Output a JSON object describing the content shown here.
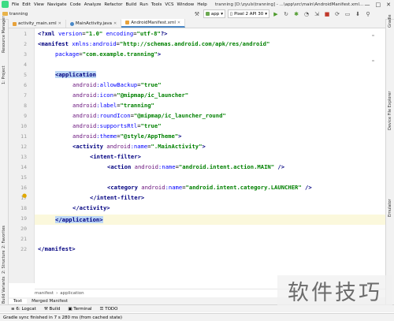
{
  "window": {
    "title": "tranning [D:\\zyuls\\tranning] - ...\\app\\src\\main\\AndroidManifest.xml [app]",
    "controls": [
      "—",
      "□",
      "✕"
    ]
  },
  "menu": [
    "File",
    "Edit",
    "View",
    "Navigate",
    "Code",
    "Analyze",
    "Refactor",
    "Build",
    "Run",
    "Tools",
    "VCS",
    "Window",
    "Help"
  ],
  "nav": {
    "project": "tranning"
  },
  "toolbar": {
    "module_combo": "app",
    "device_combo": "Pixel 2 API 30"
  },
  "left_tool_windows": [
    "1: Project",
    "Resource Manager",
    "2: Structure",
    "2: Favorites",
    "Build Variants"
  ],
  "right_tool_windows": [
    "Gradle",
    "Device File Explorer",
    "Emulator"
  ],
  "tabs": [
    {
      "label": "activity_main.xml",
      "icon_color": "#e8a23a"
    },
    {
      "label": "MainActivity.java",
      "icon_color": "#4a88c7"
    },
    {
      "label": "AndroidManifest.xml",
      "icon_color": "#e8a23a"
    }
  ],
  "line_numbers": [
    "1",
    "2",
    "3",
    "4",
    "5",
    "6",
    "7",
    "8",
    "9",
    "10",
    "11",
    "12",
    "13",
    "14",
    "15",
    "16",
    "17",
    "18",
    "19",
    "20",
    "21",
    "22"
  ],
  "code": {
    "l1": {
      "p1": "<?",
      "p2": "xml ",
      "p3": "version",
      "p4": "=",
      "p5": "\"1.0\"",
      "p6": " ",
      "p7": "encoding",
      "p8": "=",
      "p9": "\"utf-8\"",
      "p10": "?>"
    },
    "l2": {
      "p1": "<",
      "p2": "manifest ",
      "p3": "xmlns:",
      "p4": "android",
      "p5": "=",
      "p6": "\"http://schemas.android.com/apk/res/android\""
    },
    "l3": {
      "p1": "package",
      "p2": "=",
      "p3": "\"com.example.tranning\"",
      "p4": ">"
    },
    "l5": {
      "p1": "<application"
    },
    "l6": {
      "p1": "android",
      "p2": ":allowBackup",
      "p3": "=",
      "p4": "\"true\""
    },
    "l7": {
      "p1": "android",
      "p2": ":icon",
      "p3": "=",
      "p4": "\"@mipmap/ic_launcher\""
    },
    "l8": {
      "p1": "android",
      "p2": ":label",
      "p3": "=",
      "p4": "\"tranning\""
    },
    "l9": {
      "p1": "android",
      "p2": ":roundIcon",
      "p3": "=",
      "p4": "\"@mipmap/ic_launcher_round\""
    },
    "l10": {
      "p1": "android",
      "p2": ":supportsRtl",
      "p3": "=",
      "p4": "\"true\""
    },
    "l11": {
      "p1": "android",
      "p2": ":theme",
      "p3": "=",
      "p4": "\"@style/AppTheme\"",
      "p5": ">"
    },
    "l12": {
      "p1": "<activity ",
      "p2": "android",
      "p3": ":name",
      "p4": "=",
      "p5": "\".MainActivity\"",
      "p6": ">"
    },
    "l13": {
      "p1": "<intent-filter>"
    },
    "l14": {
      "p1": "<action ",
      "p2": "android",
      "p3": ":name",
      "p4": "=",
      "p5": "\"android.intent.action.MAIN\"",
      "p6": " />"
    },
    "l16": {
      "p1": "<category ",
      "p2": "android",
      "p3": ":name",
      "p4": "=",
      "p5": "\"android.intent.category.LAUNCHER\"",
      "p6": " />"
    },
    "l17": {
      "p1": "</intent-filter>"
    },
    "l18": {
      "p1": "</activity>"
    },
    "l19": {
      "p1": "</application>"
    },
    "l21": {
      "p1": "</manifest>"
    }
  },
  "breadcrumb": [
    "manifest",
    "application"
  ],
  "editor_subtabs": [
    "Text",
    "Merged Manifest"
  ],
  "bottom_tools": [
    "6: Logcat",
    "Build",
    "Terminal",
    "TODO"
  ],
  "status": "Gradle sync finished in 7 s 280 ms (from cached state)",
  "watermark": "软件技巧",
  "colors": {
    "caret_line": "#fbf8dc",
    "tag": "#000080",
    "attribute": "#0000ff",
    "namespace": "#660e7a",
    "string": "#008000"
  }
}
